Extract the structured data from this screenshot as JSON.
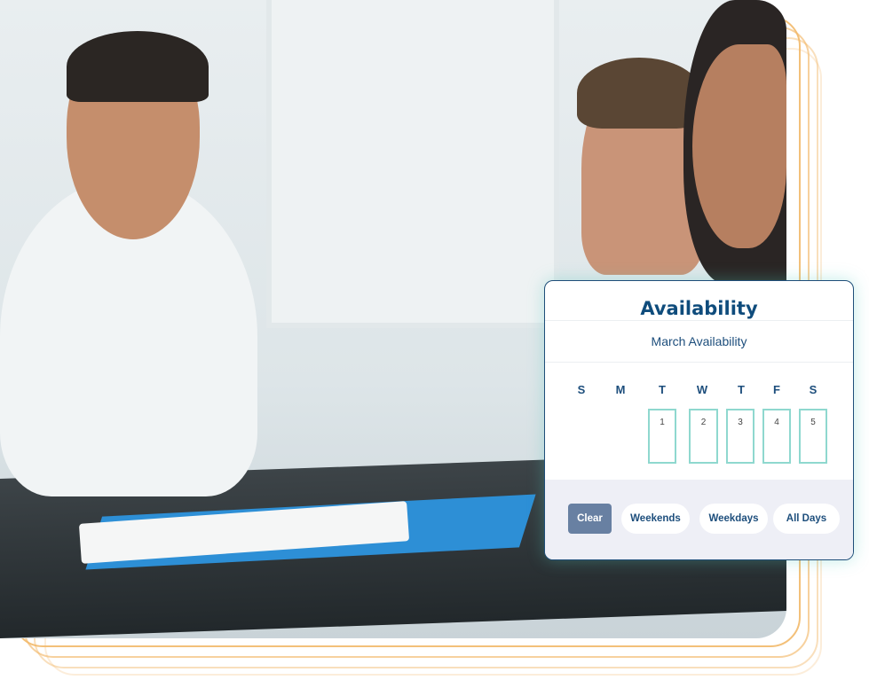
{
  "card": {
    "title": "Availability",
    "subtitle": "March Availability",
    "weekdays": [
      "S",
      "M",
      "T",
      "W",
      "T",
      "F",
      "S"
    ],
    "dates": [
      "1",
      "2",
      "3",
      "4",
      "5"
    ],
    "buttons": {
      "clear": "Clear",
      "weekends": "Weekends",
      "weekdays": "Weekdays",
      "all_days": "All Days"
    }
  },
  "colors": {
    "accent": "#0f4c7c",
    "date_border": "#8fd8cf",
    "clear_button": "#6880a2",
    "outline": "#f2b96a"
  }
}
